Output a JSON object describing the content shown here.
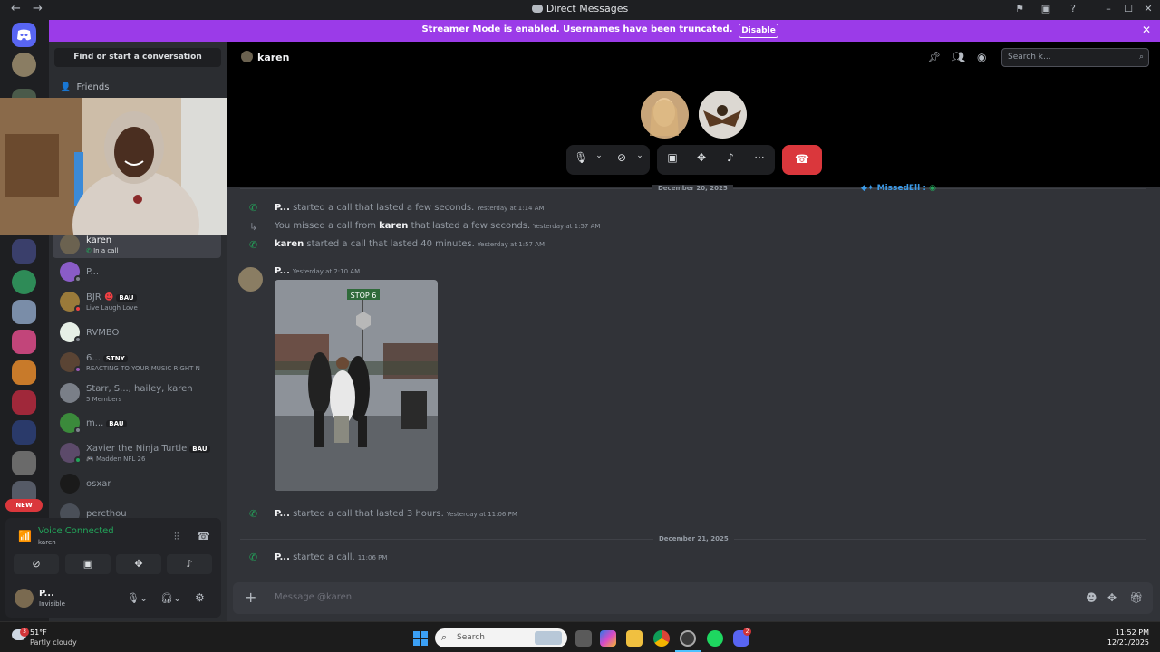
{
  "titlebar": {
    "title": "Direct Messages",
    "back": "←",
    "forward": "→"
  },
  "banner": {
    "text": "Streamer Mode is enabled. Usernames have been truncated.",
    "button": "Disable"
  },
  "sidebar": {
    "find": "Find or start a conversation",
    "friends": "Friends",
    "new_badge": "NEW",
    "dms": [
      {
        "name": "karen",
        "sub": "In a call",
        "active": true
      },
      {
        "name": "P...",
        "sub": ""
      },
      {
        "name": "BJR",
        "badge": "BAU",
        "sub": "Live Laugh Love"
      },
      {
        "name": "RVMBO",
        "sub": ""
      },
      {
        "name": "6...",
        "badge": "STNY",
        "sub": "REACTING TO YOUR MUSIC RIGHT N"
      },
      {
        "name": "Starr, S..., hailey, karen",
        "sub": "5 Members"
      },
      {
        "name": "m...",
        "badge": "BAU",
        "sub": ""
      },
      {
        "name": "Xavier the Ninja Turtle",
        "badge": "BAU",
        "sub": "Madden NFL 26"
      },
      {
        "name": "osxar",
        "sub": ""
      },
      {
        "name": "percthou",
        "sub": ""
      }
    ]
  },
  "voice": {
    "status": "Voice Connected",
    "channel": "karen"
  },
  "user": {
    "name": "P...",
    "status": "Invisible"
  },
  "main": {
    "header_name": "karen",
    "search_placeholder": "Search k...",
    "date1": "December 20, 2025",
    "date2": "December 21, 2025",
    "corner_tag": "MissedEll",
    "messages": [
      {
        "prefix": "P...",
        "text": " started a call that lasted a few seconds.",
        "time": "Yesterday at 1:14 AM"
      },
      {
        "prefix": "You missed a call from ",
        "bold": "karen",
        "text": " that lasted a few seconds.",
        "time": "Yesterday at 1:57 AM"
      },
      {
        "prefix": "karen",
        "text": " started a call that lasted 40 minutes.",
        "time": "Yesterday at 1:57 AM"
      }
    ],
    "post": {
      "author": "P...",
      "time": "Yesterday at 2:10 AM",
      "sign": "STOP 6"
    },
    "later": [
      {
        "prefix": "P...",
        "text": " started a call that lasted 3 hours.",
        "time": "Yesterday at 11:06 PM"
      },
      {
        "prefix": "P...",
        "text": " started a call.",
        "time": "11:06 PM"
      }
    ],
    "composer_placeholder": "Message @karen"
  },
  "taskbar": {
    "temp": "51°F",
    "weather": "Partly cloudy",
    "weather_badge": "3",
    "search": "Search",
    "time": "11:52 PM",
    "date": "12/21/2025",
    "discord_badge": "2"
  }
}
